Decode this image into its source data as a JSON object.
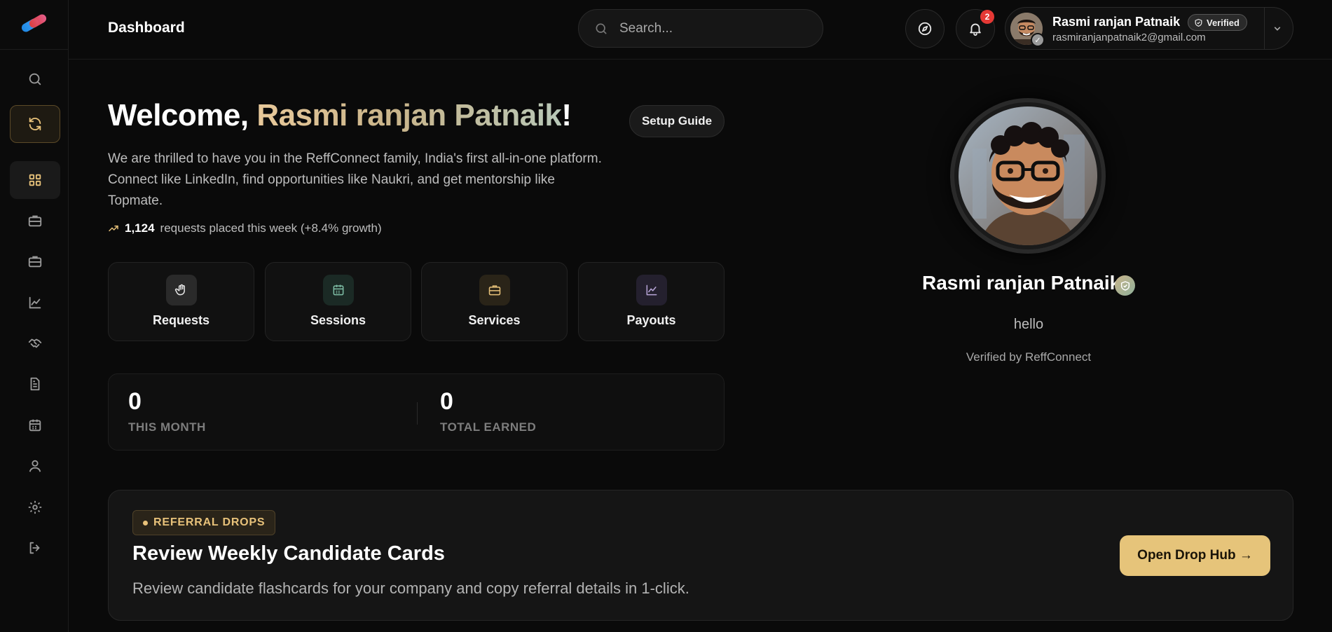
{
  "header": {
    "title": "Dashboard",
    "search_placeholder": "Search...",
    "notification_count": "2"
  },
  "user": {
    "name": "Rasmi ranjan Patnaik",
    "verified_label": "Verified",
    "email": "rasmiranjanpatnaik2@gmail.com"
  },
  "welcome": {
    "prefix": "Welcome, ",
    "name": "Rasmi ranjan Patnaik",
    "suffix": "!",
    "setup_guide": "Setup Guide",
    "intro": "We are thrilled to have you in the ReffConnect family, India's first all-in-one platform. Connect like LinkedIn, find opportunities like Naukri, and get mentorship like Topmate.",
    "growth_count": "1,124",
    "growth_text": "requests placed this week (+8.4% growth)"
  },
  "quick_actions": [
    {
      "label": "Requests",
      "icon": "hand-icon",
      "color": "#cfcfcf"
    },
    {
      "label": "Sessions",
      "icon": "calendar-icon",
      "color": "#7fbfa6"
    },
    {
      "label": "Services",
      "icon": "briefcase-icon",
      "color": "#e8c27a"
    },
    {
      "label": "Payouts",
      "icon": "chart-line-icon",
      "color": "#b8a6d8"
    }
  ],
  "stats": {
    "this_month_value": "0",
    "this_month_label": "THIS MONTH",
    "total_earned_value": "0",
    "total_earned_label": "TOTAL EARNED"
  },
  "profile": {
    "name": "Rasmi ranjan Patnaik",
    "bio": "hello",
    "verified_by": "Verified by ReffConnect"
  },
  "referral": {
    "badge": "REFERRAL DROPS",
    "title": "Review Weekly Candidate Cards",
    "description": "Review candidate flashcards for your company and copy referral details in 1-click.",
    "button": "Open Drop Hub →"
  },
  "sidebar": {
    "items": [
      "search-icon",
      "refresh-icon",
      "grid-icon",
      "briefcase-icon",
      "briefcase-icon",
      "chart-line-icon",
      "handshake-icon",
      "document-icon",
      "calendar-icon",
      "user-icon",
      "gear-icon",
      "logout-icon"
    ]
  },
  "colors": {
    "accent": "#e8c27a",
    "background": "#0a0a0a",
    "notification": "#e53935"
  }
}
